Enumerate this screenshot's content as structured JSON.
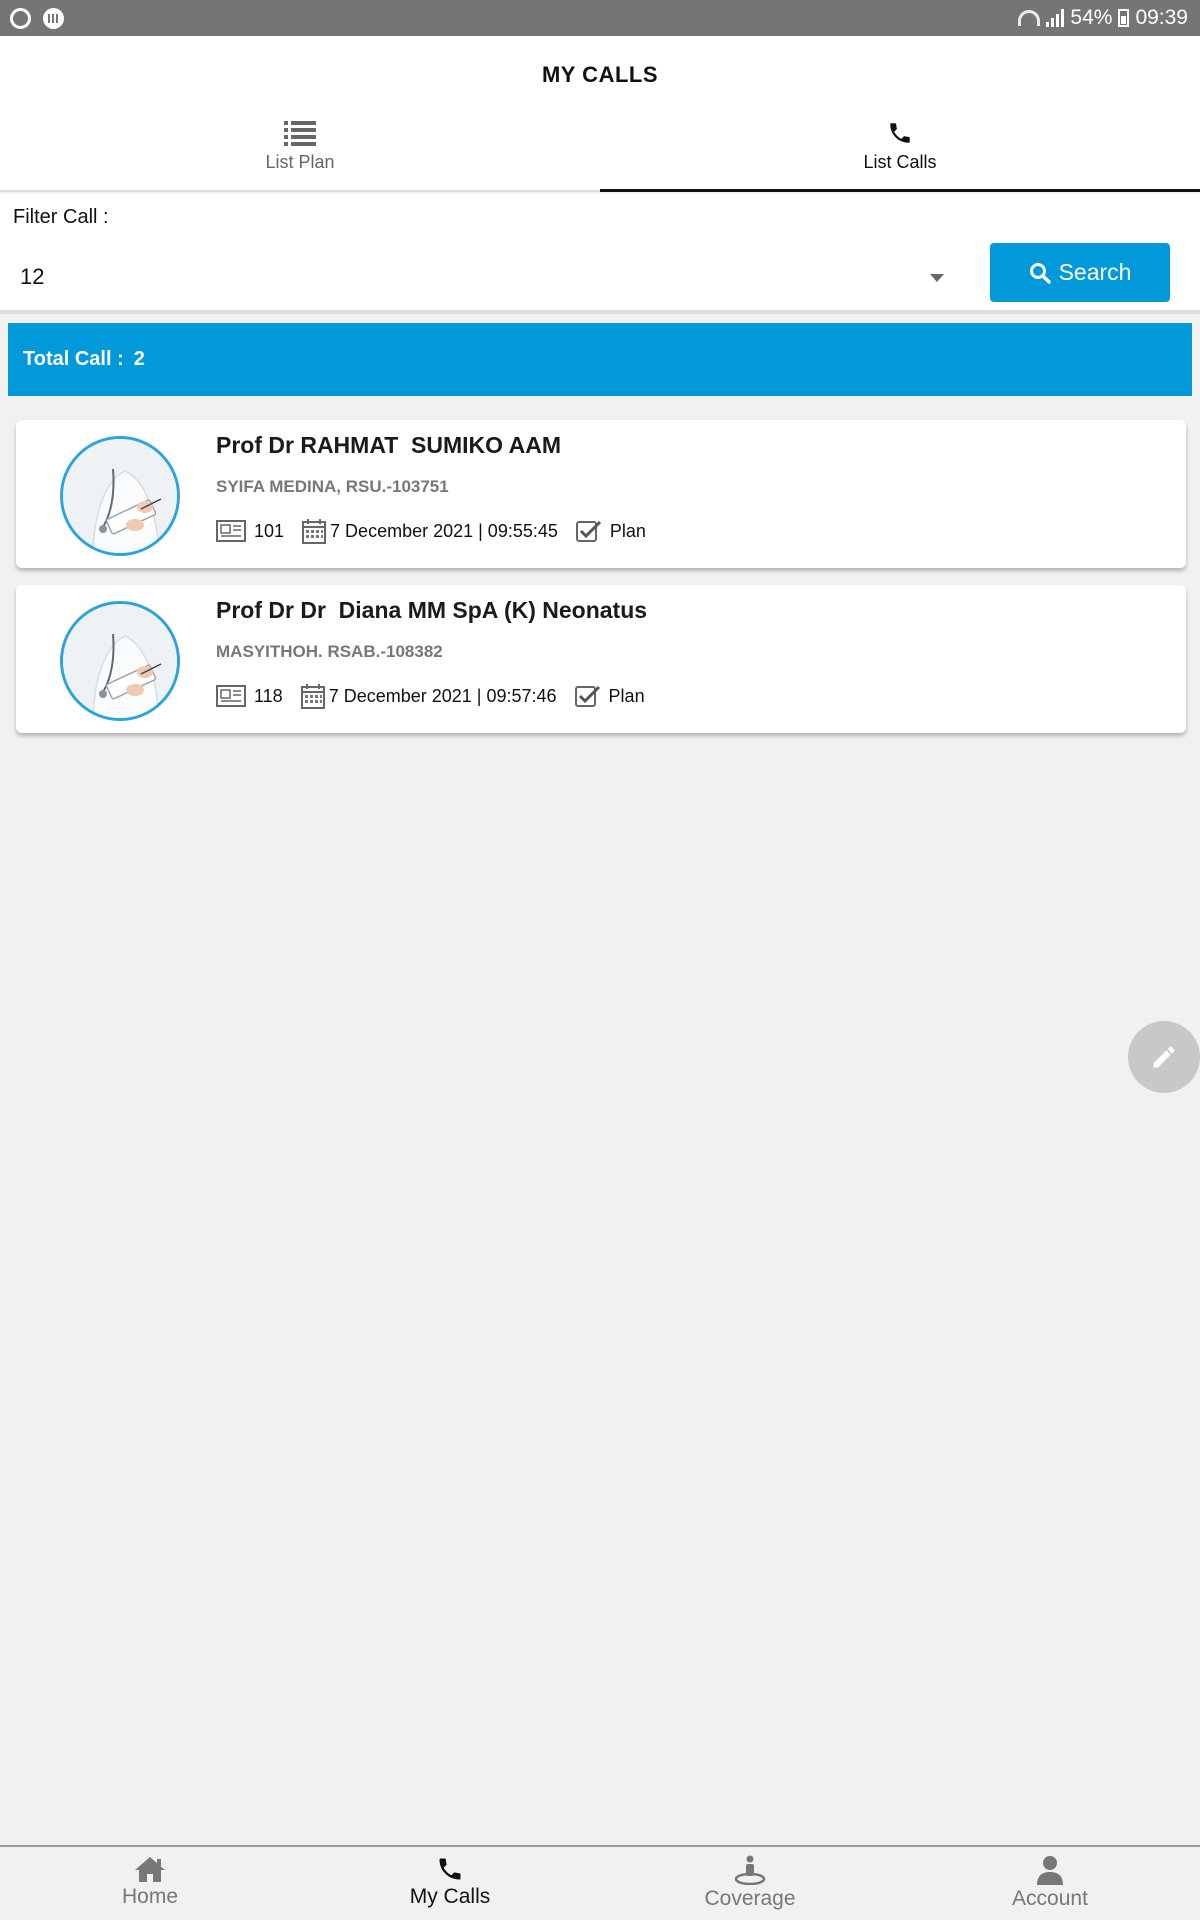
{
  "status_bar": {
    "battery": "54%",
    "time": "09:39"
  },
  "header": {
    "title": "MY CALLS"
  },
  "tabs": [
    {
      "label": "List Plan",
      "icon": "list-icon",
      "active": false
    },
    {
      "label": "List Calls",
      "icon": "phone-icon",
      "active": true
    }
  ],
  "filter": {
    "label": "Filter Call :",
    "selected": "12",
    "search_label": "Search"
  },
  "total": {
    "label": "Total Call :",
    "value": "2"
  },
  "calls": [
    {
      "name": "Prof Dr RAHMAT  SUMIKO AAM",
      "org": "SYIFA MEDINA, RSU.-103751",
      "code": "101",
      "datetime": "7 December 2021 | 09:55:45",
      "status": "Plan"
    },
    {
      "name": "Prof Dr Dr  Diana MM SpA (K) Neonatus",
      "org": "MASYITHOH. RSAB.-108382",
      "code": "118",
      "datetime": "7 December 2021 | 09:57:46",
      "status": "Plan"
    }
  ],
  "bottom_nav": [
    {
      "label": "Home",
      "icon": "home-icon",
      "active": false
    },
    {
      "label": "My Calls",
      "icon": "phone-icon",
      "active": true
    },
    {
      "label": "Coverage",
      "icon": "map-pin-person-icon",
      "active": false
    },
    {
      "label": "Account",
      "icon": "user-icon",
      "active": false
    }
  ],
  "colors": {
    "accent": "#0199d9",
    "status_bar": "#757575",
    "background": "#f1f1f1"
  }
}
